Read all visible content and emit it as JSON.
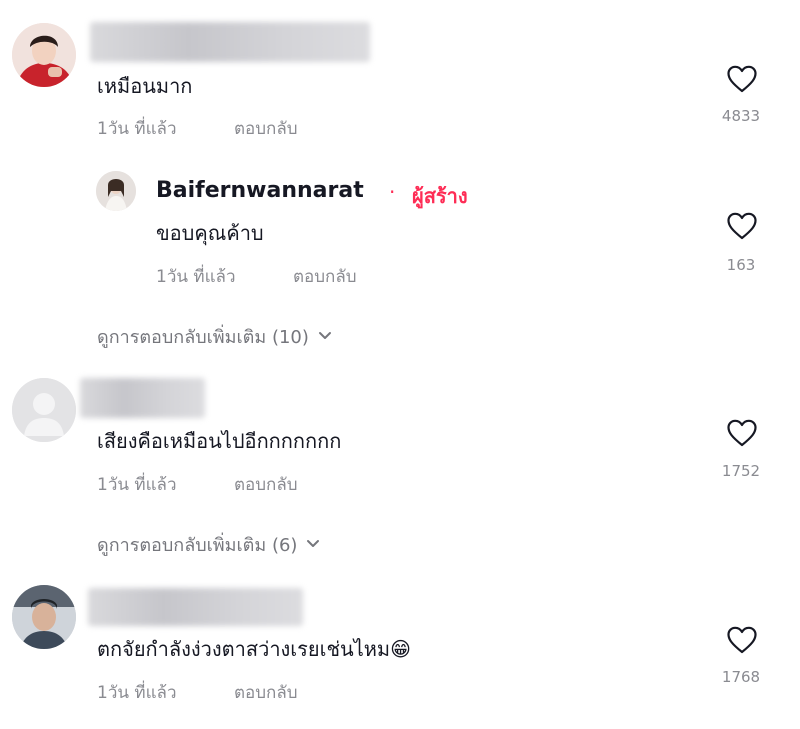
{
  "comments": [
    {
      "text": "เหมือนมาก",
      "time": "1วัน ที่แล้ว",
      "reply_label": "ตอบกลับ",
      "likes": "4833",
      "reply": {
        "username": "Baifernwannarat",
        "separator": "·",
        "creator_tag": "ผู้สร้าง",
        "text": "ขอบคุณค้าบ",
        "time": "1วัน ที่แล้ว",
        "reply_label": "ตอบกลับ",
        "likes": "163"
      },
      "view_more": "ดูการตอบกลับเพิ่มเติม (10)"
    },
    {
      "text": "เสียงคือเหมือนไปอีกกกกกกก",
      "time": "1วัน ที่แล้ว",
      "reply_label": "ตอบกลับ",
      "likes": "1752",
      "view_more": "ดูการตอบกลับเพิ่มเติม (6)"
    },
    {
      "text": "ตกจัยกำลังง่วงตาสว่างเรยเช่นไหม😁",
      "time": "1วัน ที่แล้ว",
      "reply_label": "ตอบกลับ",
      "likes": "1768"
    }
  ],
  "colors": {
    "creator_accent": "#fe2c55",
    "secondary_text": "#8a8b91"
  },
  "icons": [
    "heart-icon",
    "chevron-down-icon",
    "default-avatar-icon"
  ]
}
